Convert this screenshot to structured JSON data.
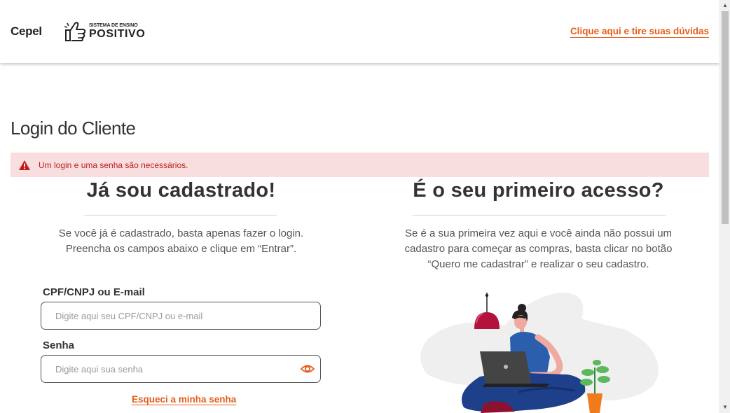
{
  "header": {
    "brand": "Cepel",
    "logo": {
      "small_text": "SISTEMA DE ENSINO",
      "big_text": "POSITIVO",
      "icon": "thumbs-up-logo-icon"
    },
    "help_link": "Clique aqui e tire suas dúvidas"
  },
  "page": {
    "title": "Login do Cliente"
  },
  "alert": {
    "icon": "warning-triangle-icon",
    "message": "Um login e uma senha são necessários."
  },
  "login": {
    "title": "Já sou cadastrado!",
    "description_line1": "Se você já é cadastrado, basta apenas fazer o login.",
    "description_line2": "Preencha os campos abaixo e clique em “Entrar”.",
    "user_label": "CPF/CNPJ ou E-mail",
    "user_value": "",
    "user_placeholder": "Digite aqui seu CPF/CNPJ ou e-mail",
    "password_label": "Senha",
    "password_value": "",
    "password_placeholder": "Digite aqui sua senha",
    "show_password_icon": "eye-icon",
    "forgot_link": "Esqueci a minha senha"
  },
  "register": {
    "title": "É o seu primeiro acesso?",
    "description_line1": "Se é a sua primeira vez aqui e você ainda não possui um",
    "description_line2": "cadastro para começar as compras, basta clicar no botão",
    "description_line3": "“Quero me cadastrar” e realizar o seu cadastro."
  },
  "colors": {
    "accent": "#e65c1a",
    "alert_bg": "#f8dede",
    "alert_text": "#c01c1c",
    "heading": "#333333"
  }
}
